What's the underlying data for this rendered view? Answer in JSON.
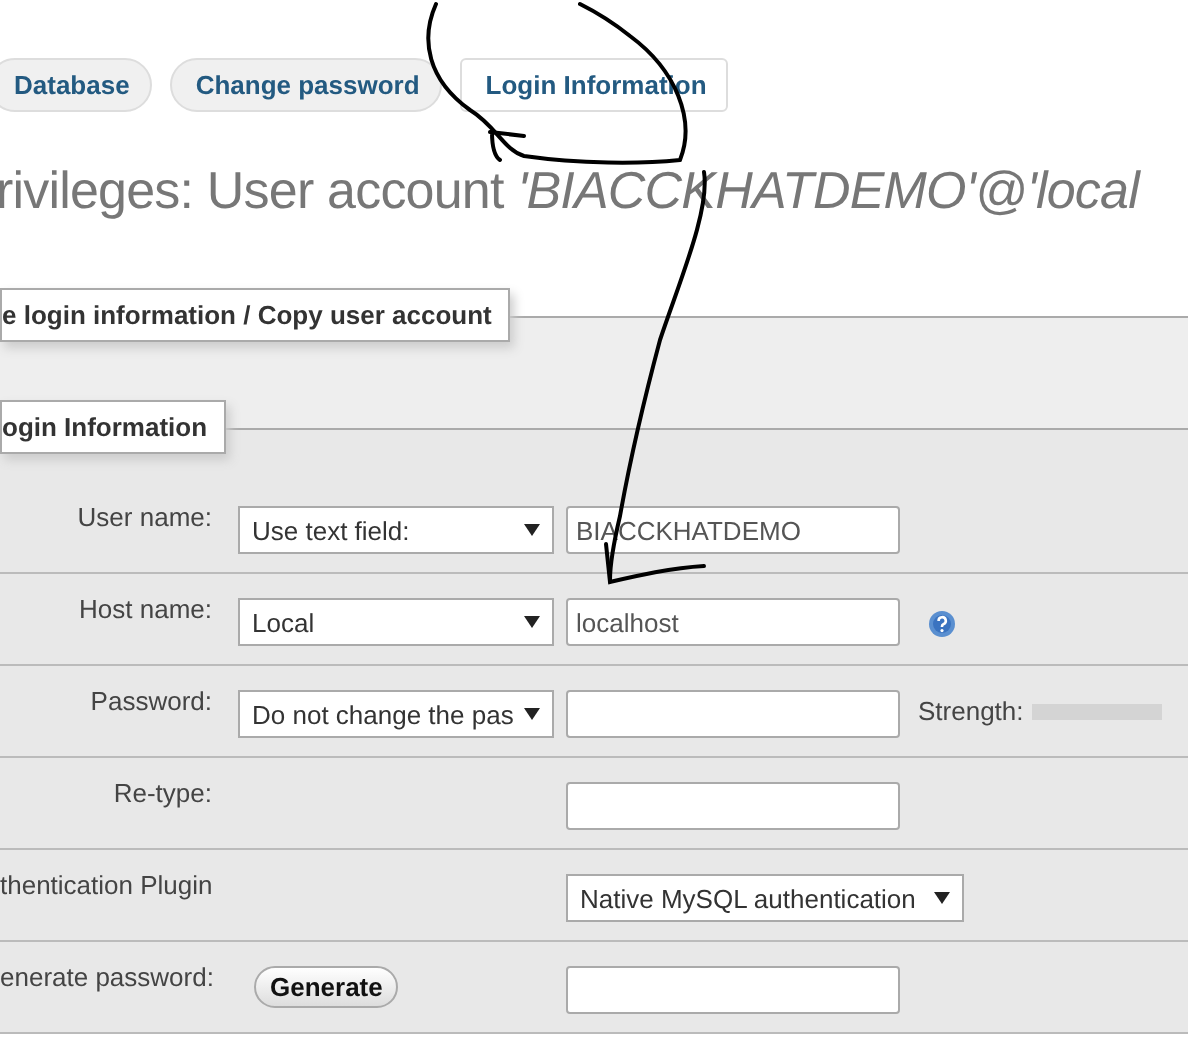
{
  "tabs": [
    {
      "label": "Database",
      "selected": false
    },
    {
      "label": "Change password",
      "selected": false
    },
    {
      "label": "Login Information",
      "selected": true
    }
  ],
  "title": "rivileges: User account *'BIACCKHATDEMO'@'local*",
  "fieldset": {
    "legend": "e login information / Copy user account",
    "inner_legend": "ogin Information",
    "rows": [
      {
        "label": "User name:",
        "select": "Use text field:",
        "input": "BIACCKHATDEMO"
      },
      {
        "label": "Host name:",
        "select": "Local",
        "input": "localhost",
        "help": true
      },
      {
        "label": "Password:",
        "select": "Do not change the pas",
        "input": "",
        "strength": "Strength:"
      },
      {
        "label": "Re-type:",
        "input": ""
      },
      {
        "label": "thentication Plugin",
        "wide_select": "Native MySQL authentication"
      },
      {
        "label": "enerate password:",
        "button": "Generate",
        "input": ""
      }
    ]
  },
  "annotation": {
    "kind": "freehand-arrow"
  }
}
